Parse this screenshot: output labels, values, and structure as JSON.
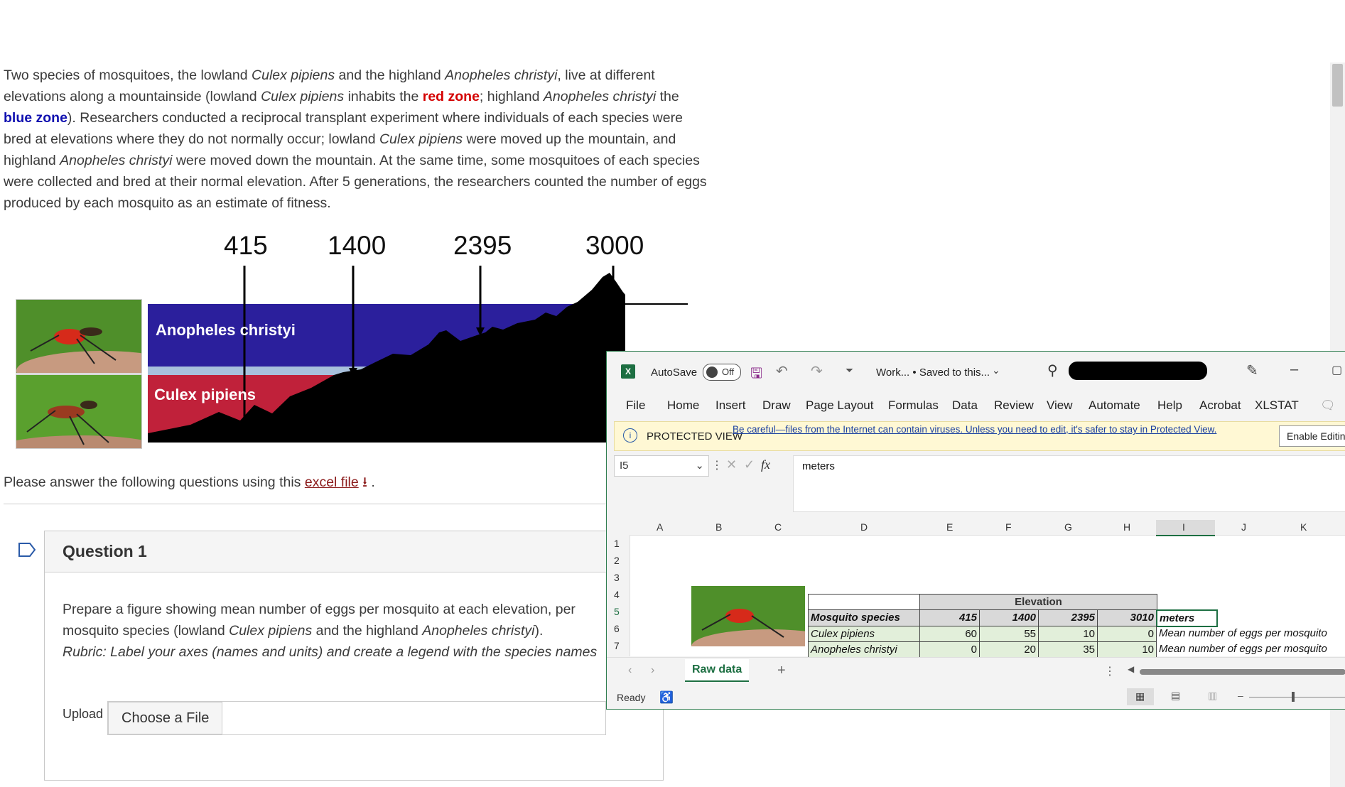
{
  "intro": {
    "p1": "Two species of mosquitoes, the lowland ",
    "sp1": "Culex pipiens",
    "p2": " and the highland ",
    "sp2": "Anopheles christyi",
    "p3": ", live at different elevations along a mountainside (lowland ",
    "sp3": "Culex pipiens",
    "p4": " inhabits the ",
    "red_zone": "red zone",
    "p5": "; highland ",
    "sp4": "Anopheles christyi",
    "p6": " the ",
    "blue_zone": "blue zone",
    "p7": "). Researchers conducted a reciprocal transplant experiment where individuals of each species were bred at elevations where they do not normally occur; lowland ",
    "sp5": "Culex pipiens",
    "p8": " were moved up the mountain, and highland ",
    "sp6": "Anopheles christyi",
    "p9": " were moved down the mountain. At the same time, some mosquitoes of each species were collected and bred at their normal elevation. After 5 generations, the researchers counted the number of eggs produced by each mosquito as an estimate of fitness."
  },
  "figure": {
    "elevations": [
      "415",
      "1400",
      "2395",
      "3000"
    ],
    "zone_top_label": "Anopheles christyi",
    "zone_bottom_label": "Culex pipiens",
    "colors": {
      "top_zone": "#2b1f9c",
      "bottom_zone": "#c0213a",
      "band": "#a8c0dc",
      "mountain": "#000000"
    }
  },
  "answer": {
    "prefix": "Please answer the following questions using this ",
    "link": "excel file",
    "suffix": " ."
  },
  "question": {
    "title": "Question 1",
    "t1": "Prepare a figure showing mean number of eggs per mosquito at each elevation, per mosquito species (lowland ",
    "sp1": "Culex pipiens",
    "t2": " and the highland ",
    "sp2": "Anopheles christyi",
    "t3": ").",
    "rubric": "Rubric: Label your axes (names and units) and create a legend with the species names",
    "upload_label": "Upload",
    "choose_button": "Choose a File"
  },
  "excel": {
    "autosave_label": "AutoSave",
    "autosave_state": "Off",
    "doc_title": "Work... • Saved to this...",
    "menu": [
      "File",
      "Home",
      "Insert",
      "Draw",
      "Page Layout",
      "Formulas",
      "Data",
      "Review",
      "View",
      "Automate",
      "Help",
      "Acrobat",
      "XLSTAT"
    ],
    "protected_label": "PROTECTED VIEW",
    "protected_msg": "Be careful—files from the Internet can contain viruses. Unless you need to edit, it's safer to stay in Protected View.",
    "enable_button": "Enable Editin",
    "name_box": "I5",
    "formula_value": "meters",
    "fx": "fx",
    "columns": [
      "A",
      "B",
      "C",
      "D",
      "E",
      "F",
      "G",
      "H",
      "I",
      "J",
      "K"
    ],
    "rows": [
      "1",
      "2",
      "3",
      "4",
      "5",
      "6",
      "7"
    ],
    "elevation_header": "Elevation",
    "species_header": "Mosquito species",
    "elev_values": [
      "415",
      "1400",
      "2395",
      "3010"
    ],
    "unit": "meters",
    "data_rows": [
      {
        "species": "Culex pipiens",
        "values": [
          "60",
          "55",
          "10",
          "0"
        ],
        "note": "Mean number of eggs per mosquito"
      },
      {
        "species": "Anopheles christyi",
        "values": [
          "0",
          "20",
          "35",
          "10"
        ],
        "note": "Mean number of eggs per mosquito"
      }
    ],
    "sheet_tab": "Raw data",
    "status": "Ready"
  }
}
